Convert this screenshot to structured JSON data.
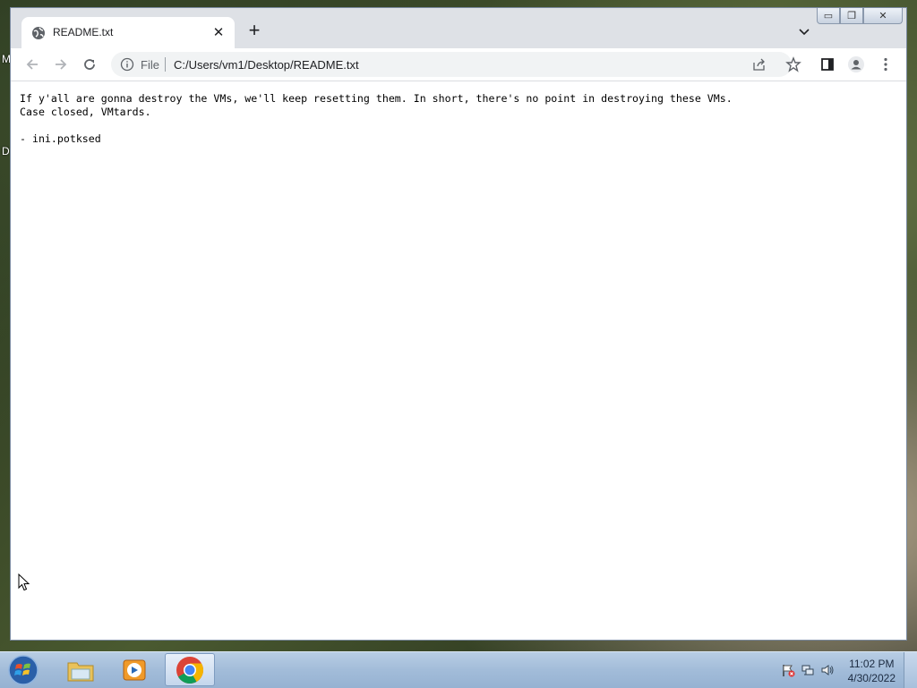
{
  "desktop": {
    "letters": [
      "M",
      "D"
    ]
  },
  "browser": {
    "tab_title": "README.txt",
    "new_tab": "+",
    "scheme": "File",
    "url": "C:/Users/vm1/Desktop/README.txt",
    "file_content": "If y'all are gonna destroy the VMs, we'll keep resetting them. In short, there's no point in destroying these VMs.\nCase closed, VMtards.\n\n- ini.potksed"
  },
  "taskbar": {
    "apps": [
      "start-orb",
      "file-explorer",
      "media-player",
      "chrome"
    ],
    "clock_time": "11:02 PM",
    "clock_date": "4/30/2022"
  }
}
